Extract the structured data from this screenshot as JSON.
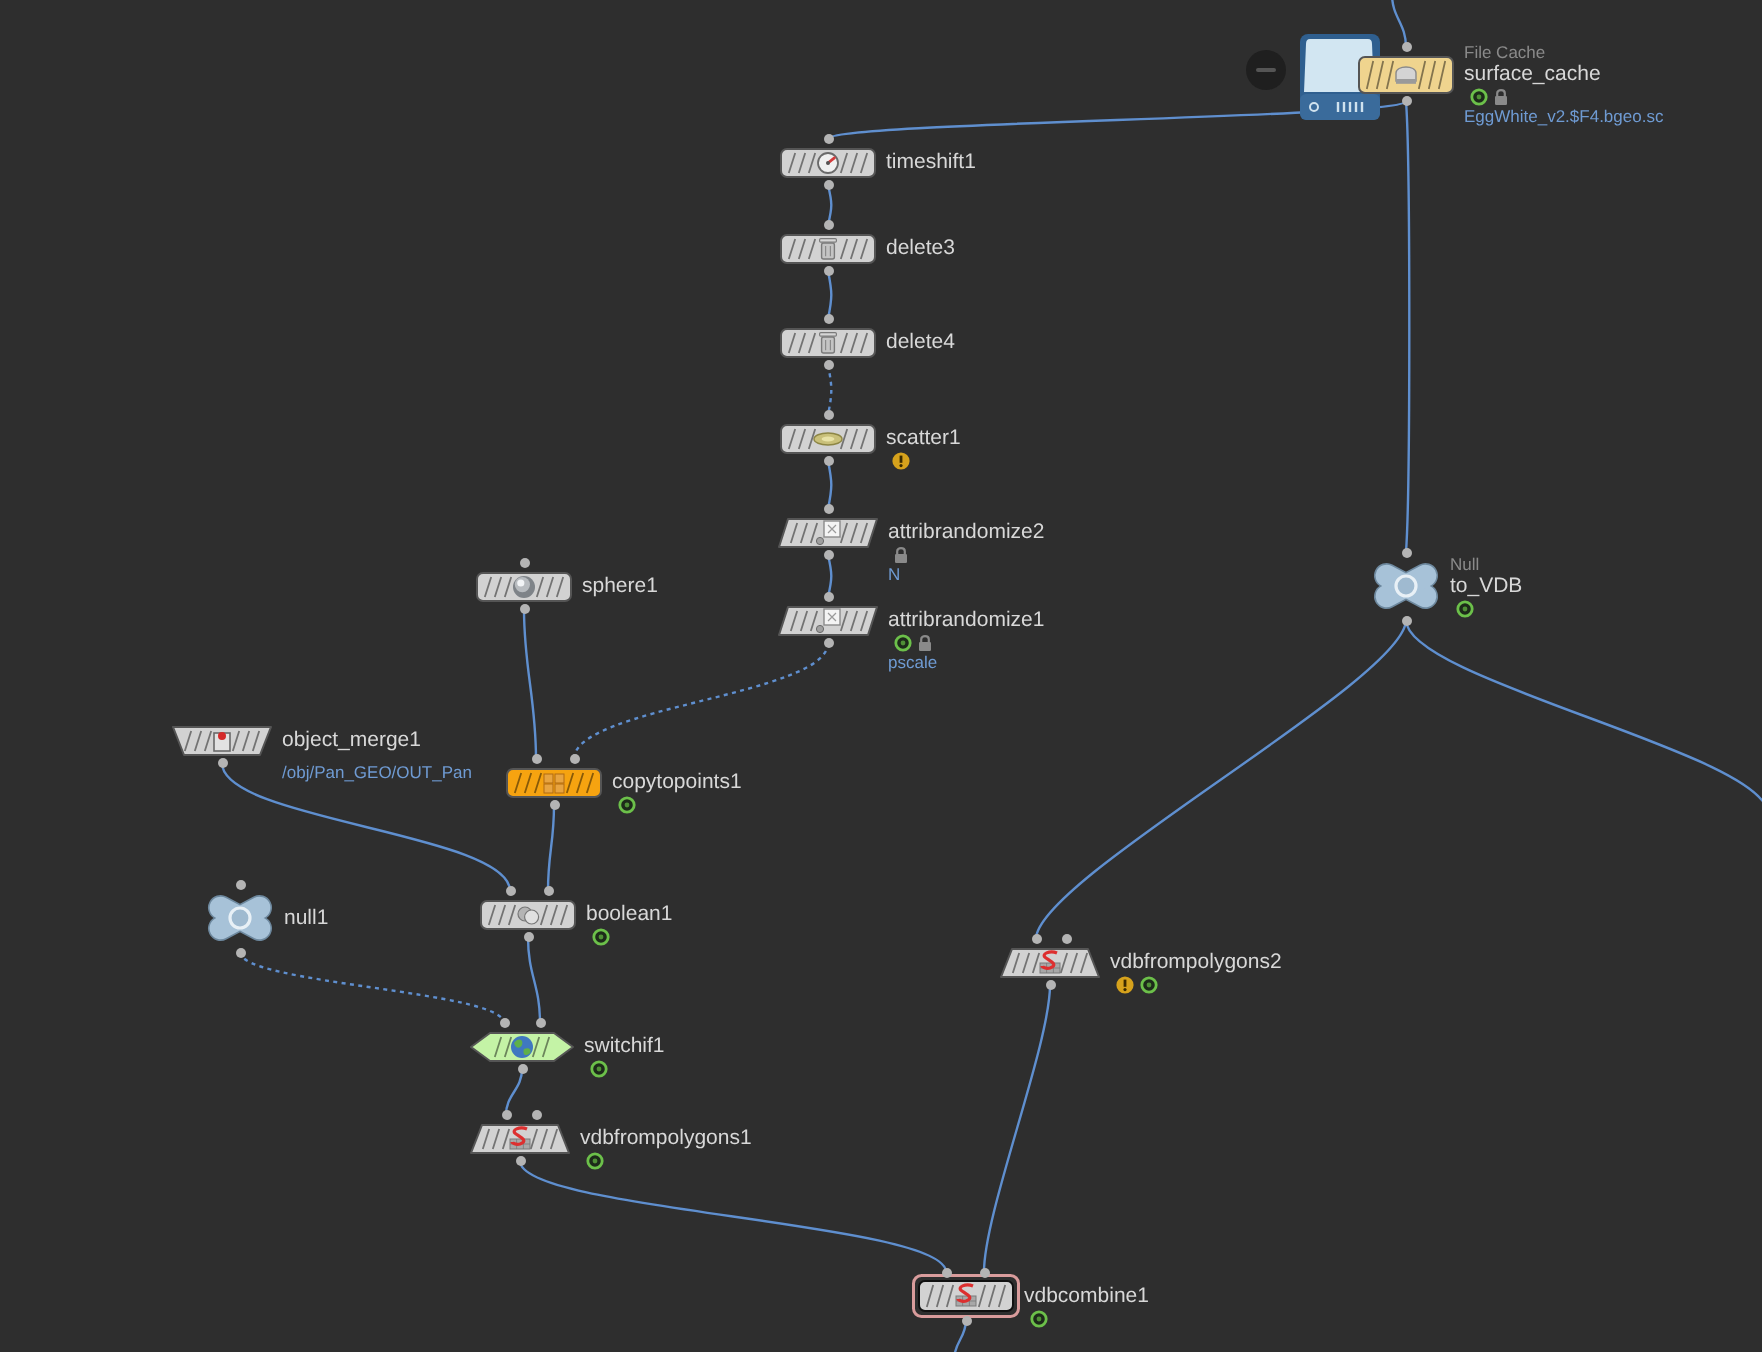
{
  "nodes": [
    {
      "name": "surface_cache",
      "kind": "filecache",
      "type_label": "File Cache",
      "color": "#efd48e",
      "selected": false,
      "warning": false,
      "ring_badge": true,
      "locked": true,
      "detail": "EggWhite_v2.$F4.bgeo.sc"
    },
    {
      "name": "timeshift1",
      "kind": "timeshift",
      "color": "#d2d2d2",
      "selected": false,
      "warning": false,
      "ring_badge": false,
      "locked": false
    },
    {
      "name": "delete3",
      "kind": "delete",
      "color": "#d2d2d2",
      "selected": false,
      "warning": false,
      "ring_badge": false,
      "locked": false
    },
    {
      "name": "delete4",
      "kind": "delete",
      "color": "#d2d2d2",
      "selected": false,
      "warning": false,
      "ring_badge": false,
      "locked": false
    },
    {
      "name": "scatter1",
      "kind": "scatter",
      "color": "#d2d2d2",
      "selected": false,
      "warning": true,
      "ring_badge": false,
      "locked": false
    },
    {
      "name": "attribrandomize2",
      "kind": "attribrandomize",
      "color": "#d2d2d2",
      "selected": false,
      "warning": false,
      "ring_badge": false,
      "locked": true,
      "detail": "N"
    },
    {
      "name": "sphere1",
      "kind": "sphere",
      "color": "#d2d2d2",
      "selected": false,
      "warning": false,
      "ring_badge": false,
      "locked": false
    },
    {
      "name": "to_VDB",
      "kind": "null",
      "type_label": "Null",
      "color": "#a7c2d8",
      "selected": false,
      "warning": false,
      "ring_badge": true,
      "locked": false
    },
    {
      "name": "attribrandomize1",
      "kind": "attribrandomize",
      "color": "#d2d2d2",
      "selected": false,
      "warning": false,
      "ring_badge": true,
      "locked": true,
      "detail": "pscale"
    },
    {
      "name": "object_merge1",
      "kind": "object_merge",
      "color": "#d2d2d2",
      "selected": false,
      "warning": false,
      "ring_badge": false,
      "locked": false,
      "detail": "/obj/Pan_GEO/OUT_Pan"
    },
    {
      "name": "copytopoints1",
      "kind": "copytopoints",
      "color": "#f6a310",
      "selected": false,
      "warning": false,
      "ring_badge": true,
      "locked": false
    },
    {
      "name": "boolean1",
      "kind": "boolean",
      "color": "#d2d2d2",
      "selected": false,
      "warning": false,
      "ring_badge": true,
      "locked": false
    },
    {
      "name": "null1",
      "kind": "null",
      "color": "#a7c2d8",
      "selected": false,
      "warning": false,
      "ring_badge": false,
      "locked": false
    },
    {
      "name": "vdbfrompolygons2",
      "kind": "vdbfrompolygons",
      "color": "#d2d2d2",
      "selected": false,
      "warning": true,
      "ring_badge": true,
      "locked": false
    },
    {
      "name": "switchif1",
      "kind": "switchif",
      "color": "#c4f3a6",
      "selected": false,
      "warning": false,
      "ring_badge": true,
      "locked": false
    },
    {
      "name": "vdbfrompolygons1",
      "kind": "vdbfrompolygons",
      "color": "#d2d2d2",
      "selected": false,
      "warning": false,
      "ring_badge": true,
      "locked": false
    },
    {
      "name": "vdbcombine1",
      "kind": "vdbcombine",
      "color": "#d2d2d2",
      "selected": true,
      "warning": false,
      "ring_badge": true,
      "locked": false
    }
  ],
  "wires": [
    {
      "dashed": false
    },
    {
      "dashed": false
    },
    {
      "dashed": false
    },
    {
      "dashed": false
    },
    {
      "dashed": false
    },
    {
      "dashed": true
    },
    {
      "dashed": false
    },
    {
      "dashed": false
    },
    {
      "dashed": true
    },
    {
      "dashed": false
    },
    {
      "dashed": false
    },
    {
      "dashed": false
    },
    {
      "dashed": true
    },
    {
      "dashed": false
    },
    {
      "dashed": false
    },
    {
      "dashed": false
    },
    {
      "dashed": false
    },
    {
      "dashed": false
    },
    {
      "dashed": false
    },
    {
      "dashed": false
    }
  ]
}
